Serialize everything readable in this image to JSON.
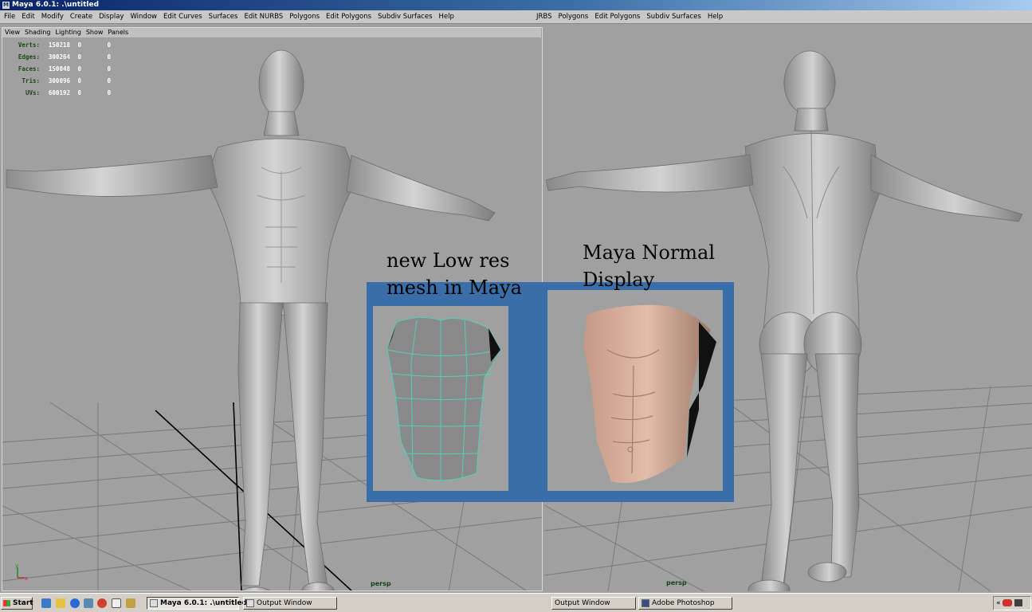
{
  "window": {
    "title": "Maya 6.0.1: .\\untitled",
    "icon": "maya-icon"
  },
  "menu_left": [
    "File",
    "Edit",
    "Modify",
    "Create",
    "Display",
    "Window",
    "Edit Curves",
    "Surfaces",
    "Edit NURBS",
    "Polygons",
    "Edit Polygons",
    "Subdiv Surfaces",
    "Help"
  ],
  "menu_right": [
    "JRBS",
    "Polygons",
    "Edit Polygons",
    "Subdiv Surfaces",
    "Help"
  ],
  "panel_menu": [
    "View",
    "Shading",
    "Lighting",
    "Show",
    "Panels"
  ],
  "hud": [
    {
      "label": "Verts:",
      "v1": "150218",
      "v2": "0",
      "v3": "0"
    },
    {
      "label": "Edges:",
      "v1": "300264",
      "v2": "0",
      "v3": "0"
    },
    {
      "label": "Faces:",
      "v1": "150048",
      "v2": "0",
      "v3": "0"
    },
    {
      "label": "Tris:",
      "v1": "300096",
      "v2": "0",
      "v3": "0"
    },
    {
      "label": "UVs:",
      "v1": "600192",
      "v2": "0",
      "v3": "0"
    }
  ],
  "viewports": {
    "left_camera": "persp",
    "right_camera": "persp"
  },
  "captions": {
    "low_res": [
      "new Low res",
      "mesh in Maya"
    ],
    "normal": [
      "Maya Normal",
      "Display"
    ]
  },
  "colors": {
    "viewport_bg": "#a0a0a0",
    "overlay_blue": "#3a6ea8",
    "wireframe": "#4fd1b8",
    "skin": "#d9ac97"
  },
  "taskbar": {
    "start_label": "Start",
    "quick_launch": [
      "browser-icon",
      "outlook-icon",
      "ie-icon",
      "maya-icon",
      "chrome-icon",
      "figure-icon",
      "pen-icon"
    ],
    "tasks": [
      {
        "label": "Maya 6.0.1: .\\untitled",
        "active": true
      },
      {
        "label": "Output Window",
        "active": false
      },
      {
        "label": "Output Window",
        "active": false
      },
      {
        "label": "Adobe Photoshop",
        "active": false
      }
    ],
    "tray_glyph": "«"
  }
}
